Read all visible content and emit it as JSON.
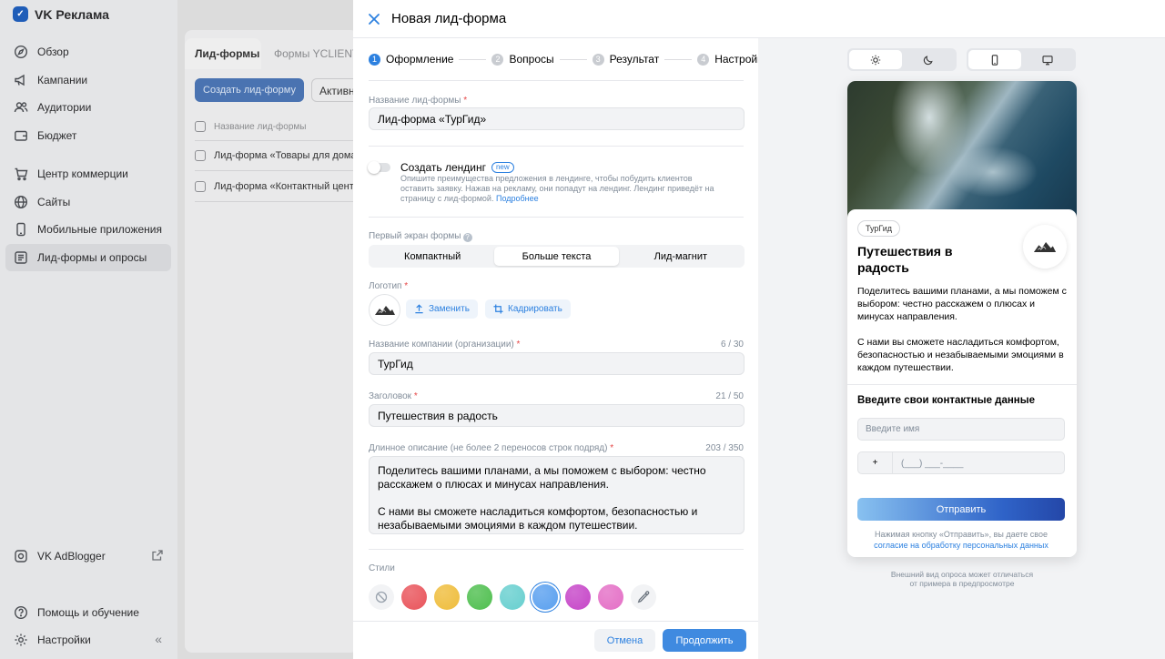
{
  "app": {
    "name": "VK Реклама"
  },
  "sidebar": {
    "items": [
      {
        "label": "Обзор",
        "icon": "compass-icon"
      },
      {
        "label": "Кампании",
        "icon": "megaphone-icon"
      },
      {
        "label": "Аудитории",
        "icon": "users-icon"
      },
      {
        "label": "Бюджет",
        "icon": "wallet-icon"
      },
      {
        "label": "Центр коммерции",
        "icon": "cart-icon"
      },
      {
        "label": "Сайты",
        "icon": "globe-icon"
      },
      {
        "label": "Мобильные приложения",
        "icon": "smartphone-icon"
      },
      {
        "label": "Лид-формы и опросы",
        "icon": "form-icon"
      }
    ],
    "active_index": 7,
    "adblogger": "VK AdBlogger",
    "help": "Помощь и обучение",
    "settings": "Настройки"
  },
  "background": {
    "tabs": [
      "Лид-формы",
      "Формы YCLIENTS"
    ],
    "create_button": "Создать лид-форму",
    "filter_button": "Активны",
    "table_header": "Название лид-формы",
    "rows": [
      "Лид-форма «Товары для дома»",
      "Лид-форма «Контактный центр»"
    ]
  },
  "modal": {
    "title": "Новая лид-форма",
    "steps": [
      {
        "num": "1",
        "label": "Оформление"
      },
      {
        "num": "2",
        "label": "Вопросы"
      },
      {
        "num": "3",
        "label": "Результат"
      },
      {
        "num": "4",
        "label": "Настройки"
      }
    ],
    "active_step": 0,
    "form_name": {
      "label": "Название лид-формы",
      "value": "Лид-форма «ТурГид»"
    },
    "landing": {
      "title": "Создать лендинг",
      "badge": "new",
      "description": "Опишите преимущества предложения в лендинге, чтобы побудить клиентов оставить заявку. Нажав на рекламу, они попадут на лендинг. Лендинг приведёт на страницу с лид-формой.",
      "more_link": "Подробнее",
      "enabled": false
    },
    "first_screen": {
      "label": "Первый экран формы",
      "options": [
        "Компактный",
        "Больше текста",
        "Лид-магнит"
      ],
      "selected_index": 1
    },
    "logo": {
      "label": "Логотип",
      "replace_button": "Заменить",
      "crop_button": "Кадрировать"
    },
    "company_name": {
      "label": "Название компании (организации)",
      "counter": "6 / 30",
      "value": "ТурГид"
    },
    "headline": {
      "label": "Заголовок",
      "counter": "21 / 50",
      "value": "Путешествия в радость"
    },
    "long_description": {
      "label": "Длинное описание (не более 2 переносов строк подряд)",
      "counter": "203 / 350",
      "value": "Поделитесь вашими планами, а мы поможем с выбором: честно расскажем о плюсах и минусах направления.\n\nС нами вы сможете насладиться комфортом, безопасностью и незабываемыми эмоциями в каждом путешествии."
    },
    "styles": {
      "label": "Стили",
      "colors": [
        "#e9545b",
        "#efbd3c",
        "#4fbf4f",
        "#67cfcf",
        "#5aa0ef",
        "#c646c8",
        "#e46fc6"
      ],
      "selected_color": "#5aa0ef"
    },
    "footer": {
      "cancel": "Отмена",
      "continue": "Продолжить"
    }
  },
  "preview": {
    "theme_options": [
      "sun-icon",
      "moon-icon"
    ],
    "device_options": [
      "phone-icon",
      "desktop-icon"
    ],
    "chip": "ТурГид",
    "heading": "Путешествия в радость",
    "description": "Поделитесь вашими планами, а мы поможем с выбором: честно расскажем о плюсах и минусах направления.\n\nС нами вы сможете насладиться комфортом, безопасностью и незабываемыми эмоциями в каждом путешествии.",
    "contact_title": "Введите свои контактные данные",
    "name_placeholder": "Введите имя",
    "phone_code": "+",
    "phone_mask": "(___) ___-____",
    "submit": "Отправить",
    "consent_text": "Нажимая кнопку «Отправить», вы даете свое",
    "consent_link": "согласие на обработку персональных данных",
    "note": "Внешний вид опроса может отличаться\nот примера в предпросмотре"
  }
}
